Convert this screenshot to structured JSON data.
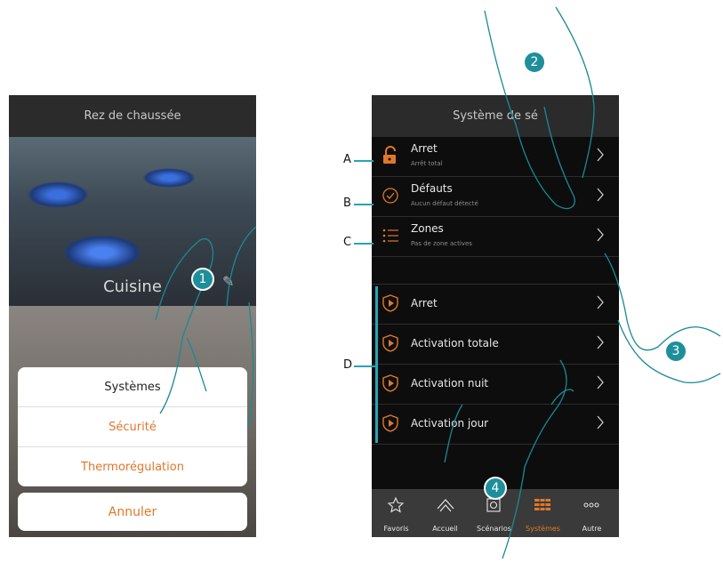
{
  "left_screen": {
    "header_title": "Rez de chaussée",
    "room_name": "Cuisine",
    "sheet_items": [
      {
        "label": "Systèmes",
        "color": "#222222"
      },
      {
        "label": "Sécurité",
        "color": "#e0782a"
      },
      {
        "label": "Thermorégulation",
        "color": "#e0782a"
      }
    ],
    "cancel_label": "Annuler"
  },
  "right_screen": {
    "header_title": "Système de sé",
    "status_rows": [
      {
        "title": "Arret",
        "subtitle": "Arrêt total",
        "icon": "open-lock-icon"
      },
      {
        "title": "Défauts",
        "subtitle": "Aucun défaut détecté",
        "icon": "check-circle-icon"
      },
      {
        "title": "Zones",
        "subtitle": "Pas de zone actives",
        "icon": "zones-list-icon"
      }
    ],
    "scenario_rows": [
      {
        "title": "Arret",
        "icon": "shield-play-icon"
      },
      {
        "title": "Activation totale",
        "icon": "shield-play-icon"
      },
      {
        "title": "Activation nuit",
        "icon": "shield-play-icon"
      },
      {
        "title": "Activation jour",
        "icon": "shield-play-icon"
      }
    ],
    "tabs": [
      {
        "label": "Favoris",
        "icon": "star-icon",
        "active": false
      },
      {
        "label": "Accueil",
        "icon": "home-icon",
        "active": false
      },
      {
        "label": "Scénarios",
        "icon": "scenario-icon",
        "active": false
      },
      {
        "label": "Systèmes",
        "icon": "systems-grid-icon",
        "active": true
      },
      {
        "label": "Autre",
        "icon": "more-dots-icon",
        "active": false
      }
    ]
  },
  "callouts": {
    "step_markers": [
      "1",
      "2",
      "3",
      "4"
    ],
    "letters": [
      "A",
      "B",
      "C",
      "D"
    ]
  },
  "colors": {
    "accent_orange": "#e0782a",
    "marker_teal": "#1e8f9a",
    "lead_line": "#2aa3b5"
  }
}
